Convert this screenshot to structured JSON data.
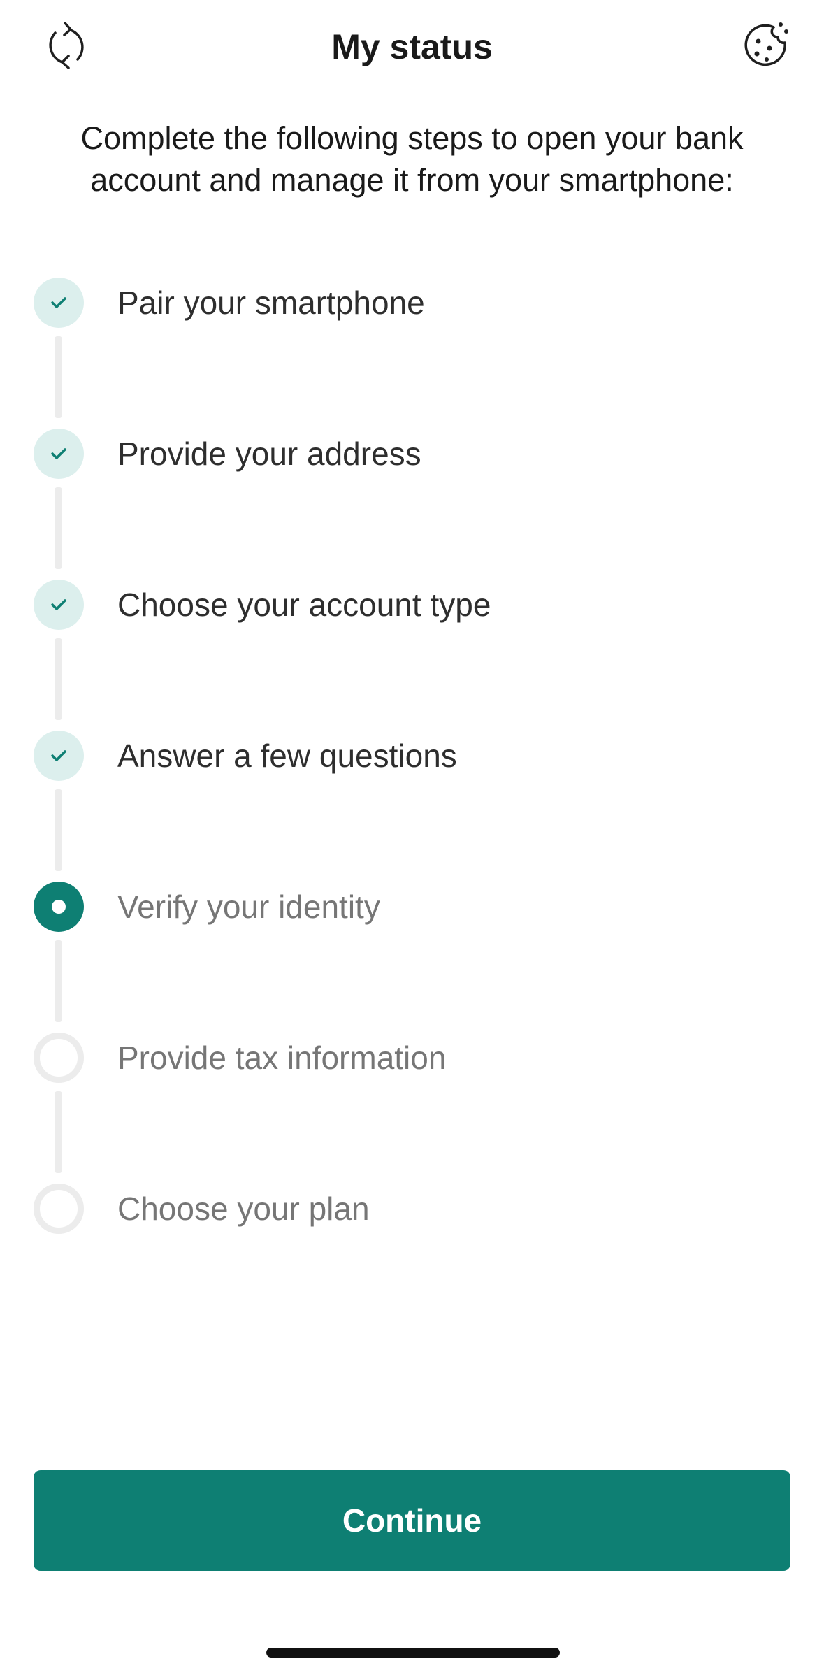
{
  "header": {
    "title": "My status",
    "left_icon": "refresh-icon",
    "right_icon": "cookie-icon"
  },
  "intro_text": "Complete the following steps to open your bank account and manage it from your smartphone:",
  "steps": [
    {
      "label": "Pair your smartphone",
      "status": "done"
    },
    {
      "label": "Provide your address",
      "status": "done"
    },
    {
      "label": "Choose your account type",
      "status": "done"
    },
    {
      "label": "Answer a few questions",
      "status": "done"
    },
    {
      "label": "Verify your identity",
      "status": "current"
    },
    {
      "label": "Provide tax information",
      "status": "pending"
    },
    {
      "label": "Choose your plan",
      "status": "pending"
    }
  ],
  "continue_label": "Continue",
  "colors": {
    "accent": "#0e7f73",
    "done_marker_bg": "#dcefed",
    "pending_ring": "#ececec"
  }
}
